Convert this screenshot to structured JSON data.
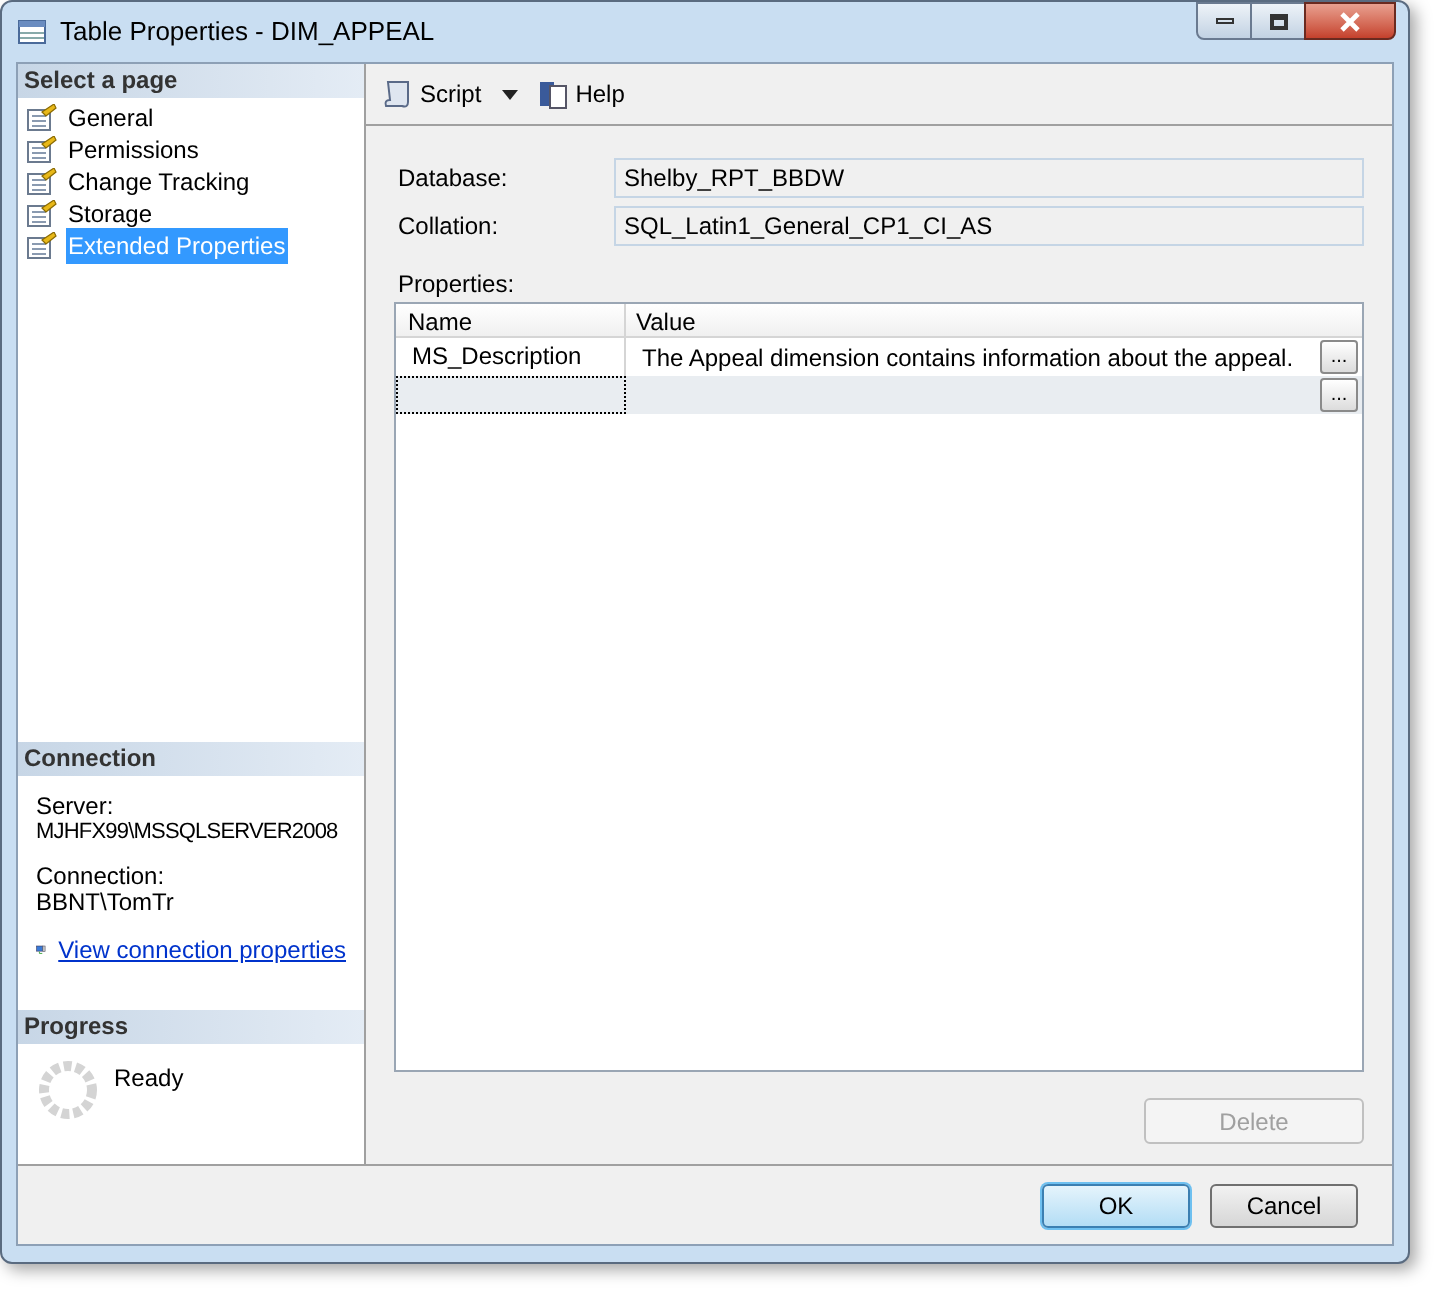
{
  "window": {
    "title": "Table Properties - DIM_APPEAL"
  },
  "sidebar": {
    "header": "Select a page",
    "pages": [
      {
        "label": "General",
        "selected": false
      },
      {
        "label": "Permissions",
        "selected": false
      },
      {
        "label": "Change Tracking",
        "selected": false
      },
      {
        "label": "Storage",
        "selected": false
      },
      {
        "label": "Extended Properties",
        "selected": true
      }
    ],
    "connection": {
      "header": "Connection",
      "server_label": "Server:",
      "server": "MJHFX99\\MSSQLSERVER2008",
      "connection_label": "Connection:",
      "connection": "BBNT\\TomTr",
      "link": "View connection properties"
    },
    "progress": {
      "header": "Progress",
      "status": "Ready"
    }
  },
  "toolbar": {
    "script": "Script",
    "help": "Help"
  },
  "fields": [
    {
      "label": "Database:",
      "value": "Shelby_RPT_BBDW"
    },
    {
      "label": "Collation:",
      "value": "SQL_Latin1_General_CP1_CI_AS"
    }
  ],
  "properties": {
    "label": "Properties:",
    "columns": [
      "Name",
      "Value"
    ],
    "rows": [
      {
        "name": "MS_Description",
        "value": "The Appeal dimension contains information about the appeal.",
        "ellipsis": "...",
        "focused": false
      },
      {
        "ellipsis": "...",
        "focused": true
      }
    ]
  },
  "delete_button": {
    "label": "Delete",
    "disabled": true
  },
  "buttons": [
    {
      "label": "OK",
      "default": true
    },
    {
      "label": "Cancel",
      "default": false
    }
  ]
}
